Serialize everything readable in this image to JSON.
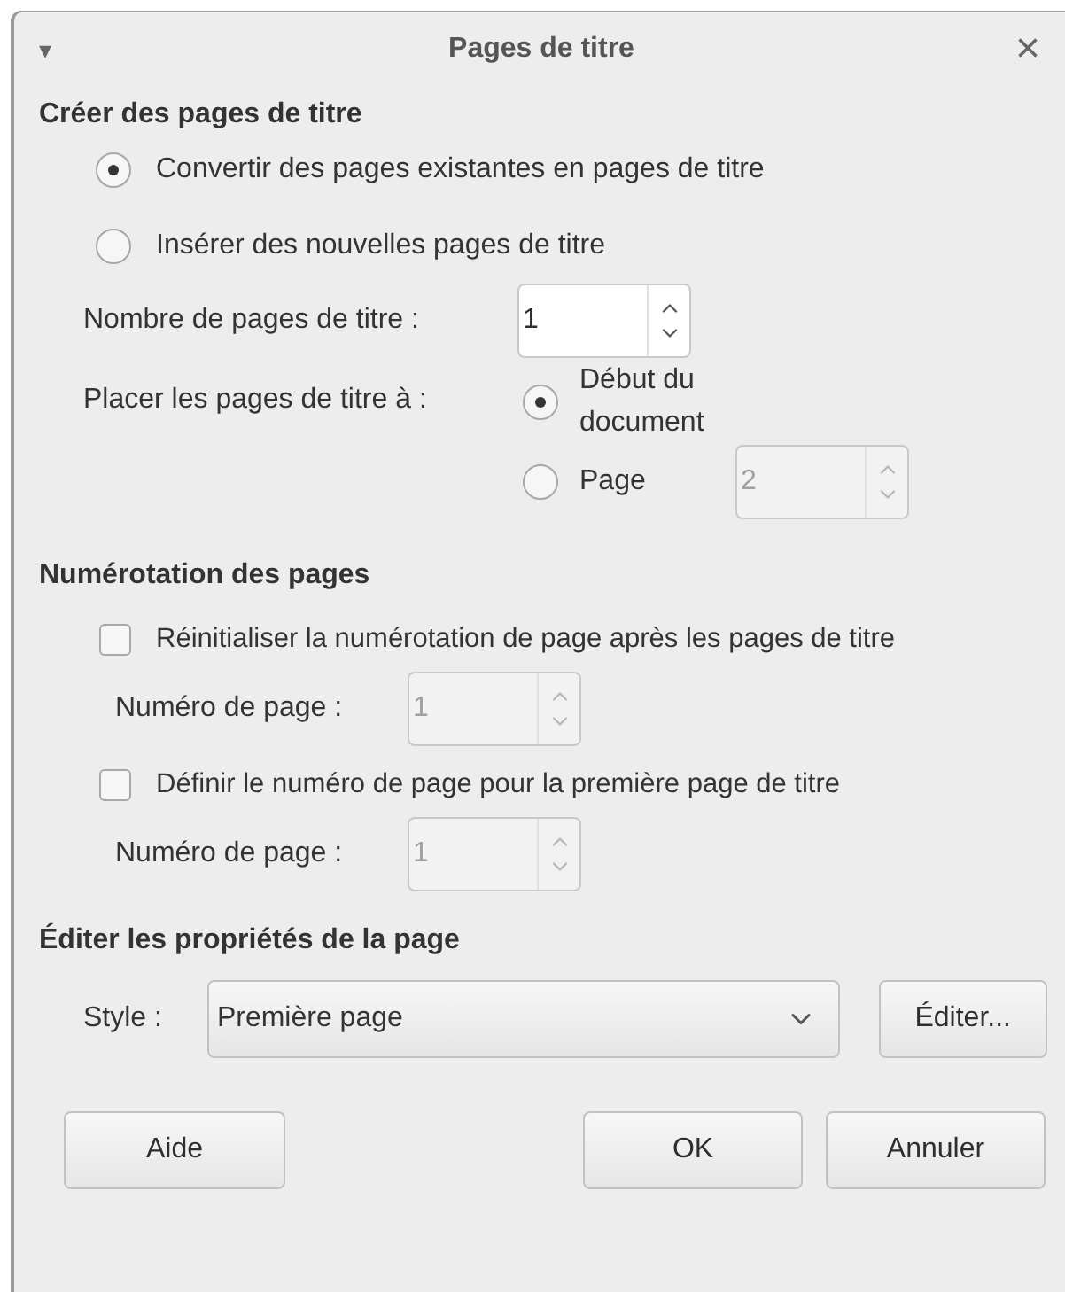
{
  "window": {
    "title": "Pages de titre",
    "menu_icon": "▾",
    "close": "×"
  },
  "create": {
    "heading": "Créer des pages de titre",
    "mode_options": [
      {
        "label": "Convertir des pages existantes en pages de titre",
        "selected": true
      },
      {
        "label": "Insérer des nouvelles pages de titre",
        "selected": false
      }
    ],
    "count": {
      "label": "Nombre de pages de titre :",
      "value": "1",
      "disabled": false
    },
    "place": {
      "label": "Placer les pages de titre à :",
      "options": [
        {
          "label": "Début du document",
          "selected": true
        },
        {
          "label": "Page",
          "selected": false,
          "spin": {
            "value": "2",
            "disabled": true
          }
        }
      ]
    }
  },
  "numbering": {
    "heading": "Numérotation des pages",
    "options": [
      {
        "label": "Réinitialiser la numérotation de page après les pages de titre",
        "checked": false,
        "spin_label": "Numéro de page :",
        "spin": {
          "value": "1",
          "disabled": true
        }
      },
      {
        "label": "Définir le numéro de page pour la première page de titre",
        "checked": false,
        "spin_label": "Numéro de page :",
        "spin": {
          "value": "1",
          "disabled": true
        }
      }
    ]
  },
  "properties": {
    "heading": "Éditer les propriétés de la page",
    "style_label": "Style :",
    "style_value": "Première page",
    "edit_button": "Éditer..."
  },
  "buttons": {
    "help": "Aide",
    "ok": "OK",
    "cancel": "Annuler"
  }
}
